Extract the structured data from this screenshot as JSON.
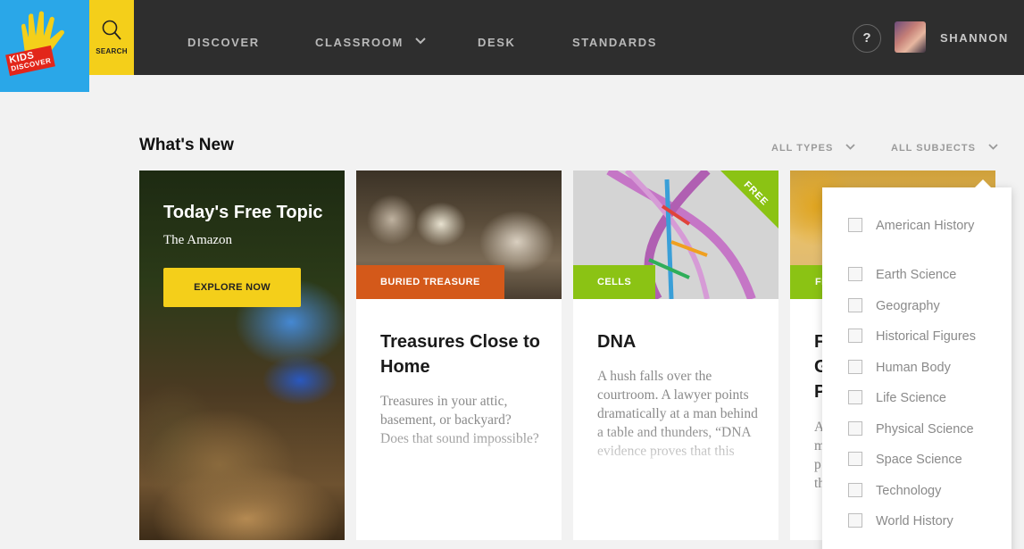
{
  "header": {
    "logo_line1": "KIDS",
    "logo_line2": "DISCOVER",
    "search_label": "SEARCH",
    "nav": [
      {
        "label": "DISCOVER"
      },
      {
        "label": "CLASSROOM"
      },
      {
        "label": "DESK"
      },
      {
        "label": "STANDARDS"
      }
    ],
    "help_label": "?",
    "username": "SHANNON"
  },
  "section": {
    "title": "What's New",
    "filters": [
      {
        "label": "ALL TYPES"
      },
      {
        "label": "ALL SUBJECTS"
      }
    ]
  },
  "feature": {
    "title": "Today's Free Topic",
    "subtitle": "The Amazon",
    "button": "EXPLORE NOW"
  },
  "cards": [
    {
      "tag": "BURIED TREASURE",
      "tag_color": "#d4591a",
      "title": "Treasures Close to Home",
      "description": "Treasures in your attic, basement, or backyard? Does that sound impossible?"
    },
    {
      "tag": "CELLS",
      "tag_color": "#8bc314",
      "ribbon": "FREE",
      "title": "DNA",
      "description": "A hush falls over the courtroom. A lawyer points dramatically at a man behind a table and thunders, “DNA evidence proves that this"
    },
    {
      "tag": "FI",
      "tag_color": "#8bc314",
      "title": "F G P",
      "description": "A m p th"
    }
  ],
  "subjects_dropdown": {
    "options": [
      {
        "label": "American History",
        "checked": false
      },
      {
        "label": "Earth Science",
        "checked": false
      },
      {
        "label": "Geography",
        "checked": false
      },
      {
        "label": "Historical Figures",
        "checked": false
      },
      {
        "label": "Human Body",
        "checked": false
      },
      {
        "label": "Life Science",
        "checked": false
      },
      {
        "label": "Physical Science",
        "checked": false
      },
      {
        "label": "Space Science",
        "checked": false
      },
      {
        "label": "Technology",
        "checked": false
      },
      {
        "label": "World History",
        "checked": false
      }
    ]
  },
  "colors": {
    "topbar": "#2e2e2e",
    "logo_bg": "#2aa7e8",
    "search_bg": "#f4cf1a",
    "accent_yellow": "#f4cf1a",
    "tag_orange": "#d4591a",
    "tag_green": "#8bc314"
  }
}
